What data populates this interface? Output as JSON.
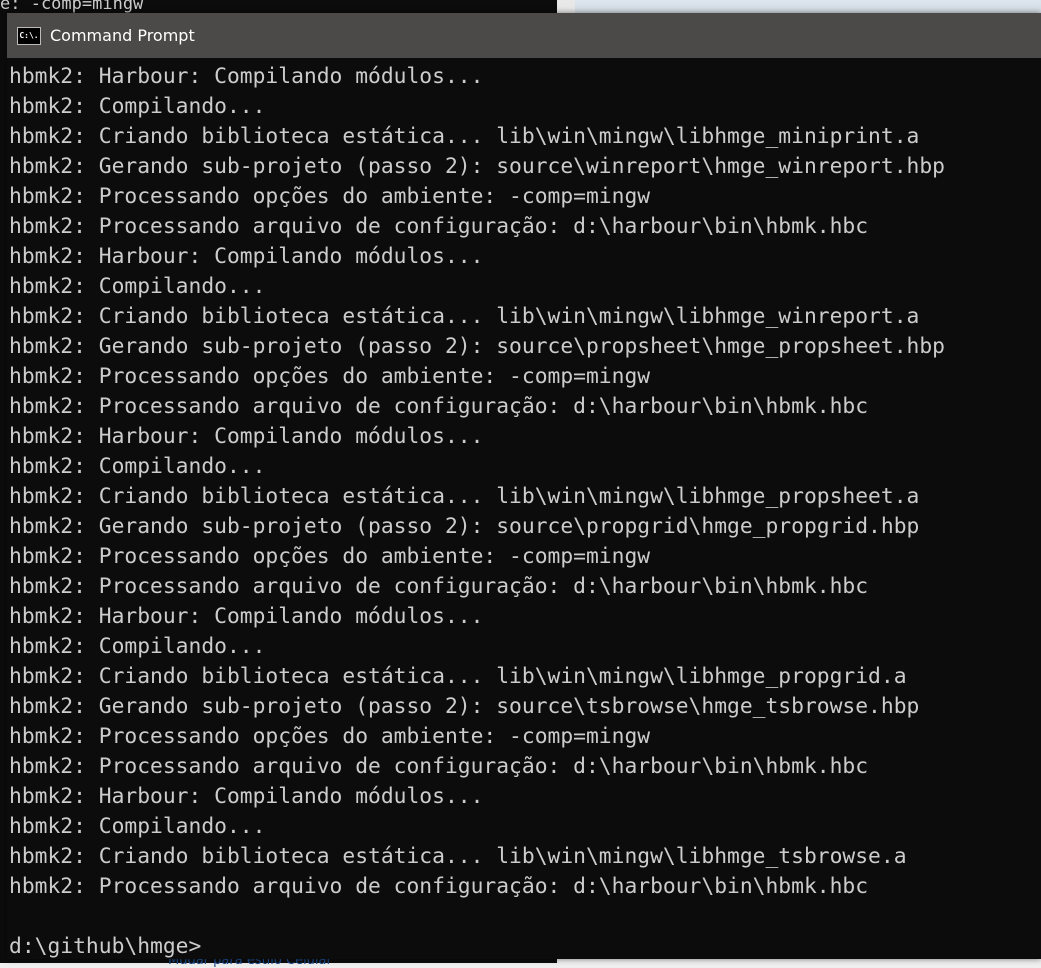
{
  "background": {
    "top_text": "e: -comp=mingw",
    "bottom_text": "Mudar para estilo Celular"
  },
  "window": {
    "title": "Command Prompt",
    "icon": "cmd-icon",
    "icon_text": "C:\\."
  },
  "console": {
    "lines": [
      "hbmk2: Harbour: Compilando módulos...",
      "hbmk2: Compilando...",
      "hbmk2: Criando biblioteca estática... lib\\win\\mingw\\libhmge_miniprint.a",
      "hbmk2: Gerando sub-projeto (passo 2): source\\winreport\\hmge_winreport.hbp",
      "hbmk2: Processando opções do ambiente: -comp=mingw",
      "hbmk2: Processando arquivo de configuração: d:\\harbour\\bin\\hbmk.hbc",
      "hbmk2: Harbour: Compilando módulos...",
      "hbmk2: Compilando...",
      "hbmk2: Criando biblioteca estática... lib\\win\\mingw\\libhmge_winreport.a",
      "hbmk2: Gerando sub-projeto (passo 2): source\\propsheet\\hmge_propsheet.hbp",
      "hbmk2: Processando opções do ambiente: -comp=mingw",
      "hbmk2: Processando arquivo de configuração: d:\\harbour\\bin\\hbmk.hbc",
      "hbmk2: Harbour: Compilando módulos...",
      "hbmk2: Compilando...",
      "hbmk2: Criando biblioteca estática... lib\\win\\mingw\\libhmge_propsheet.a",
      "hbmk2: Gerando sub-projeto (passo 2): source\\propgrid\\hmge_propgrid.hbp",
      "hbmk2: Processando opções do ambiente: -comp=mingw",
      "hbmk2: Processando arquivo de configuração: d:\\harbour\\bin\\hbmk.hbc",
      "hbmk2: Harbour: Compilando módulos...",
      "hbmk2: Compilando...",
      "hbmk2: Criando biblioteca estática... lib\\win\\mingw\\libhmge_propgrid.a",
      "hbmk2: Gerando sub-projeto (passo 2): source\\tsbrowse\\hmge_tsbrowse.hbp",
      "hbmk2: Processando opções do ambiente: -comp=mingw",
      "hbmk2: Processando arquivo de configuração: d:\\harbour\\bin\\hbmk.hbc",
      "hbmk2: Harbour: Compilando módulos...",
      "hbmk2: Compilando...",
      "hbmk2: Criando biblioteca estática... lib\\win\\mingw\\libhmge_tsbrowse.a",
      "hbmk2: Processando arquivo de configuração: d:\\harbour\\bin\\hbmk.hbc",
      "",
      "d:\\github\\hmge>"
    ]
  }
}
